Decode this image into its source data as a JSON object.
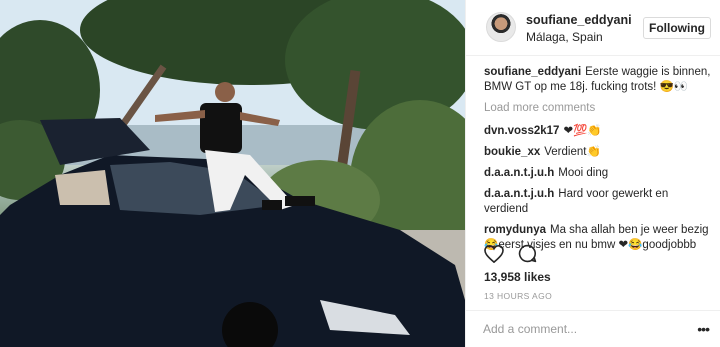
{
  "post": {
    "username": "soufiane_eddyani",
    "location": "Málaga, Spain",
    "follow_label": "Following",
    "caption_user": "soufiane_eddyani",
    "caption_text": "Eerste waggie is binnen, BMW GT op me 18j. fucking trots! 😎👀",
    "load_more": "Load more comments",
    "likes": "13,958 likes",
    "timestamp": "13 HOURS AGO",
    "add_comment_placeholder": "Add a comment...",
    "more_icon": "ellipsis-icon",
    "heart_icon": "heart-icon",
    "comment_icon": "comment-bubble-icon"
  },
  "comments": [
    {
      "user": "dvn.voss2k17",
      "text": "❤💯👏"
    },
    {
      "user": "boukie_xx",
      "text": "Verdient👏"
    },
    {
      "user": "d.a.a.n.t.j.u.h",
      "text": "Mooi ding"
    },
    {
      "user": "d.a.a.n.t.j.u.h",
      "text": "Hard voor gewerkt en verdiend"
    },
    {
      "user": "romydunya",
      "text": "Ma sha allah ben je weer bezig 😂eerst visjes en nu bmw ❤😂goodjobbb"
    }
  ],
  "colors": {
    "text": "#262626",
    "muted": "#999999",
    "border": "#efefef"
  }
}
